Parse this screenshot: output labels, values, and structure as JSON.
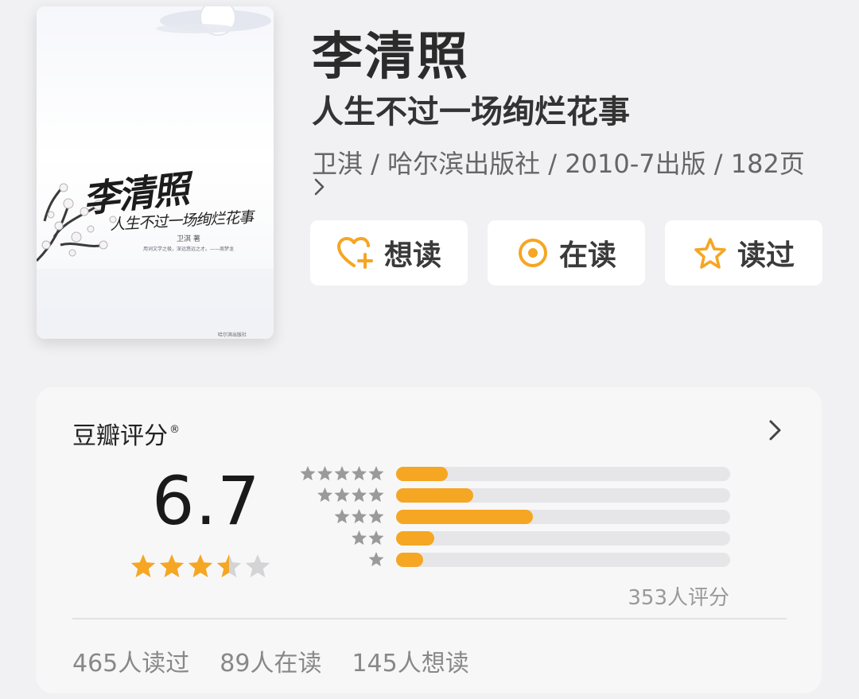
{
  "cover": {
    "title": "李清照",
    "subtitle": "人生不过一场绚烂花事",
    "author": "卫淇 著",
    "quote": "用词文学之极，深远悠远之才。——周梦龙",
    "publisher": "哈尔滨出版社"
  },
  "book": {
    "title": "李清照",
    "subtitle": "人生不过一场绚烂花事",
    "meta": "卫淇 / 哈尔滨出版社 / 2010-7出版 / 182页"
  },
  "actions": {
    "want_label": "想读",
    "reading_label": "在读",
    "read_label": "读过"
  },
  "rating": {
    "title": "豆瓣评分",
    "registered_mark": "®",
    "score": "6.7",
    "score_stars": 3.5,
    "count_label": "353人评分",
    "distribution": [
      {
        "stars": 5,
        "fraction": 0.155
      },
      {
        "stars": 4,
        "fraction": 0.23
      },
      {
        "stars": 3,
        "fraction": 0.41
      },
      {
        "stars": 2,
        "fraction": 0.115
      },
      {
        "stars": 1,
        "fraction": 0.08
      }
    ]
  },
  "stats": {
    "read": "465人读过",
    "reading": "89人在读",
    "want": "145人想读"
  },
  "colors": {
    "accent": "#f5a623",
    "star_gray": "#9a9a9a",
    "star_empty": "#d4d4d6",
    "background": "#f1f1f3",
    "card": "#f7f7f8"
  }
}
